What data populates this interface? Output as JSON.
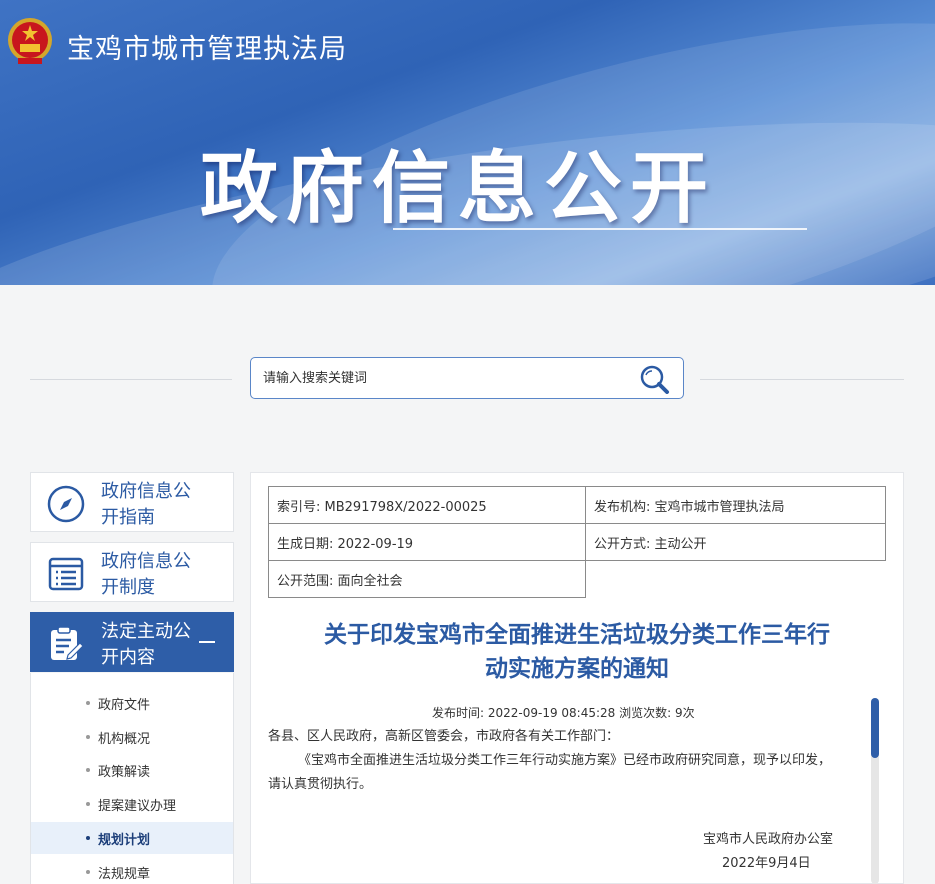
{
  "header": {
    "site_name": "宝鸡市城市管理执法局",
    "banner_title": "政府信息公开"
  },
  "search": {
    "placeholder": "请输入搜索关键词"
  },
  "sidebar": {
    "cards": [
      {
        "label": "政府信息公开指南",
        "icon": "compass-icon"
      },
      {
        "label": "政府信息公开制度",
        "icon": "document-list-icon"
      },
      {
        "label": "法定主动公开内容",
        "icon": "edit-document-icon"
      }
    ],
    "sub_items": [
      "政府文件",
      "机构概况",
      "政策解读",
      "提案建议办理",
      "规划计划",
      "法规规章"
    ],
    "current_sub_item": "规划计划"
  },
  "meta": {
    "index_no": "索引号: MB291798X/2022-00025",
    "publisher": "发布机构: 宝鸡市城市管理执法局",
    "generated_date": "生成日期: 2022-09-19",
    "disclosure_method": "公开方式: 主动公开",
    "scope": "公开范围: 面向全社会"
  },
  "document": {
    "title_line1": "关于印发宝鸡市全面推进生活垃圾分类工作三年行",
    "title_line2": "动实施方案的通知",
    "publish_info": "发布时间: 2022-09-19 08:45:28 浏览次数: 9次",
    "salutation": "各县、区人民政府，高新区管委会，市政府各有关工作部门：",
    "body_line1": "《宝鸡市全面推进生活垃圾分类工作三年行动实施方案》已经市政府研究同意，现予以印发，",
    "body_line2": "请认真贯彻执行。",
    "signature_org": "宝鸡市人民政府办公室",
    "signature_date": "2022年9月4日"
  },
  "colors": {
    "brand_blue": "#2e5ea8",
    "title_blue": "#2b5aa3"
  }
}
